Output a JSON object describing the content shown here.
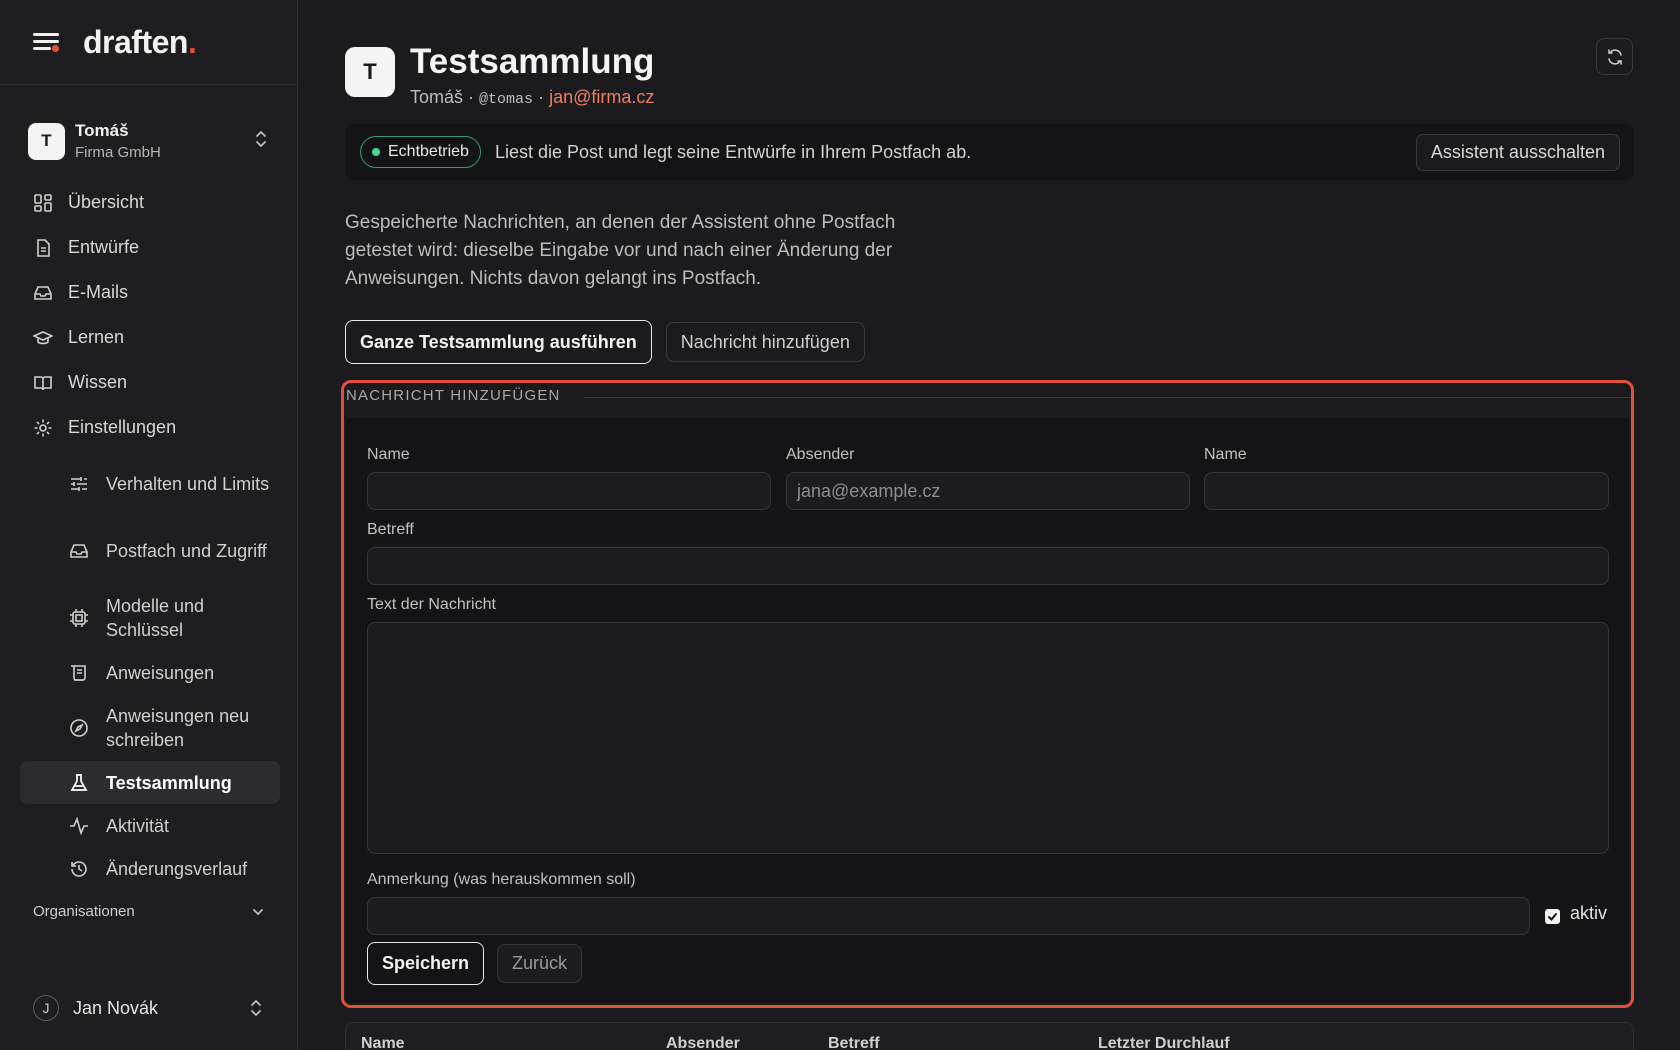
{
  "brand": {
    "name": "draften",
    "dot": "."
  },
  "account": {
    "initial": "T",
    "name": "Tomáš",
    "org": "Firma GmbH"
  },
  "nav": {
    "items": [
      {
        "label": "Übersicht",
        "icon": "dashboard-icon"
      },
      {
        "label": "Entwürfe",
        "icon": "document-icon"
      },
      {
        "label": "E-Mails",
        "icon": "inbox-icon"
      },
      {
        "label": "Lernen",
        "icon": "graduation-cap-icon"
      },
      {
        "label": "Wissen",
        "icon": "book-icon"
      },
      {
        "label": "Einstellungen",
        "icon": "gear-icon"
      }
    ],
    "sub": [
      {
        "label": "Verhalten und Limits",
        "icon": "sliders-icon"
      },
      {
        "label": "Postfach und Zugriff",
        "icon": "inbox-icon"
      },
      {
        "label": "Modelle und Schlüssel",
        "icon": "chip-icon"
      },
      {
        "label": "Anweisungen",
        "icon": "scroll-icon"
      },
      {
        "label": "Anweisungen neu schreiben",
        "icon": "compass-icon"
      },
      {
        "label": "Testsammlung",
        "icon": "flask-icon"
      },
      {
        "label": "Aktivität",
        "icon": "activity-icon"
      },
      {
        "label": "Änderungsverlauf",
        "icon": "history-icon"
      }
    ],
    "orgs_label": "Organisationen"
  },
  "user": {
    "initial": "J",
    "name": "Jan Novák"
  },
  "header": {
    "initial": "T",
    "title": "Testsammlung",
    "owner": "Tomáš",
    "sep": "·",
    "handle": "@tomas",
    "email": "jan@firma.cz"
  },
  "status": {
    "badge": "Echtbetrieb",
    "text": "Liest die Post und legt seine Entwürfe in Ihrem Postfach ab.",
    "button": "Assistent ausschalten"
  },
  "intro": "Gespeicherte Nachrichten, an denen der Assistent ohne Postfach getestet wird: dieselbe Eingabe vor und nach einer Änderung der Anweisungen. Nichts davon gelangt ins Postfach.",
  "actions": {
    "run": "Ganze Testsammlung ausführen",
    "add": "Nachricht hinzufügen"
  },
  "form": {
    "legend": "NACHRICHT HINZUFÜGEN",
    "name_label": "Name",
    "sender_label": "Absender",
    "sender_placeholder": "jana@example.cz",
    "name2_label": "Name",
    "subject_label": "Betreff",
    "body_label": "Text der Nachricht",
    "note_label": "Anmerkung (was herauskommen soll)",
    "active_label": "aktiv",
    "active": true,
    "save": "Speichern",
    "back": "Zurück"
  },
  "table": {
    "columns": [
      "Name",
      "Absender",
      "Betreff",
      "Letzter Durchlauf"
    ]
  },
  "colors": {
    "accent": "#e4503e",
    "email": "#ef7e63",
    "live": "#4ad39a",
    "highlight": "#e2503c"
  }
}
